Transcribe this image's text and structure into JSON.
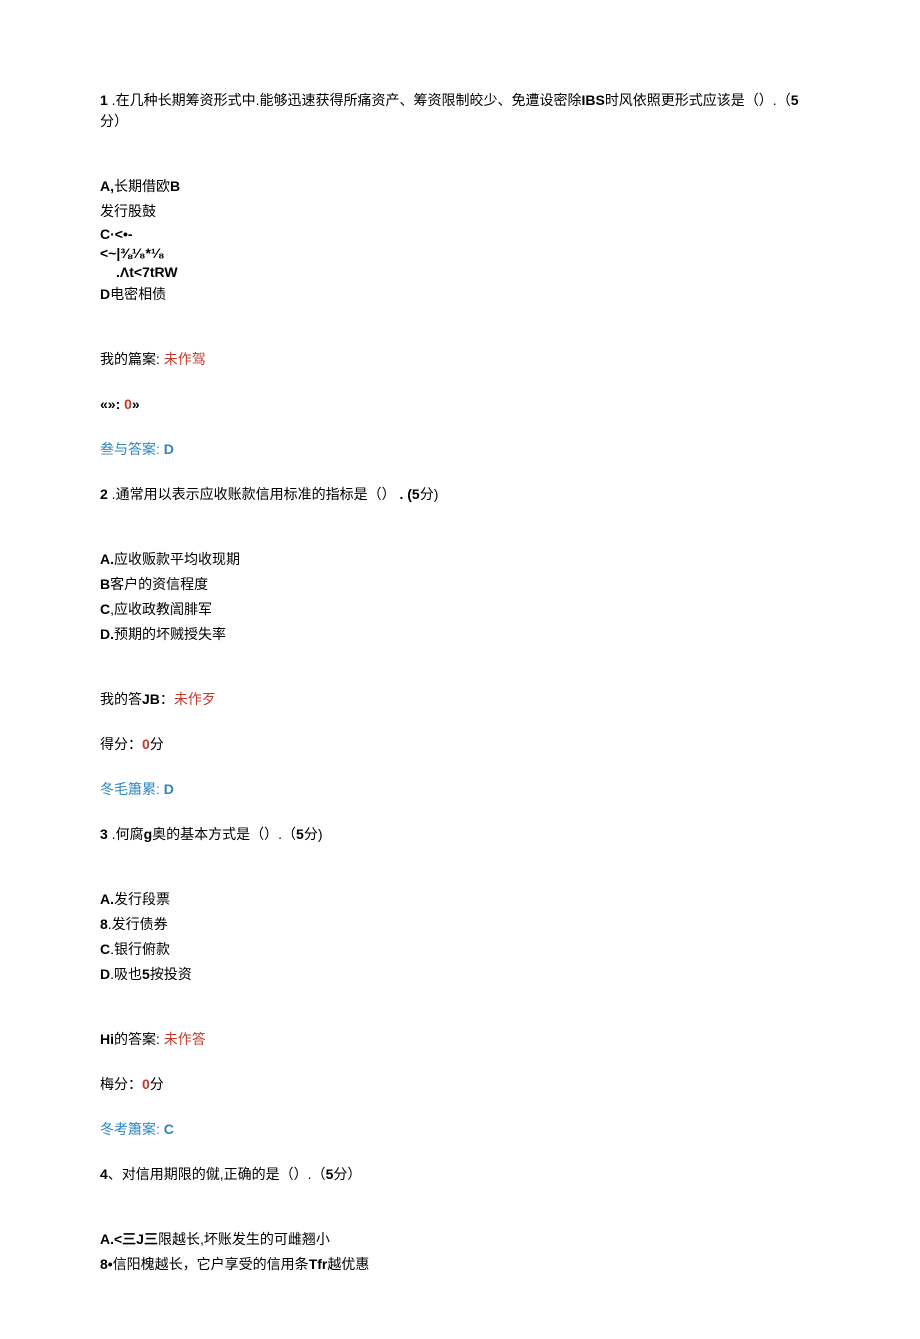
{
  "q1": {
    "number": "1",
    "text": " .在几种长期筹资形式中.能够迅速获得所痛资产、筹资限制皎少、免遭设密除",
    "keyword": "IBS",
    "text2": "时风依照更形式应该是（）.（",
    "pts_num": "5",
    "pts_unit": "分）",
    "options": {
      "A": {
        "label": "A,",
        "text": "长期借欧",
        "tail": "B"
      },
      "B": {
        "text": "发行股鼓"
      },
      "C": {
        "label": "C",
        "text": "·<•-"
      },
      "garble1": "<~|⅜¹⁄₈*¹⁄₈",
      "garble2": ".Λt<7tRW",
      "D": {
        "label": "D",
        "text": "电密相债"
      }
    },
    "myAnswerLabel": "我的篇案: ",
    "myAnswerStatus": "未作驾",
    "scoreLabel": "«»: ",
    "scoreValue": "0",
    "scoreUnit": "»",
    "refLabel": "叁与答案: ",
    "refAnswer": "D"
  },
  "q2": {
    "number": "2",
    "text": " .通常用以表示应收账款信用标准的指标是（）",
    "pts_label": " . (",
    "pts_num": "5",
    "pts_unit": "分)",
    "options": {
      "A": {
        "label": "A.",
        "text": "应收贩款平均收现期"
      },
      "B": {
        "label": "B",
        "text": "客户的资信程度"
      },
      "C": {
        "label": "C",
        "text": ",应收政教訚腓军"
      },
      "D": {
        "label": "D.",
        "text": "预期的坏贼授失率"
      }
    },
    "myAnswerLabel": "我的答",
    "myAnswerMid": "JB",
    "myAnswerColon": "：",
    "myAnswerStatus": "未作歹",
    "scoreLabel": "得分：",
    "scoreValue": "0",
    "scoreUnit": "分",
    "refLabel": "冬毛簫累: ",
    "refAnswer": "D"
  },
  "q3": {
    "number": "3",
    "text": " .何腐",
    "keyword": "g",
    "text2": "奥的基本方式是（）.（",
    "pts_num": "5",
    "pts_unit": "分)",
    "options": {
      "A": {
        "label": "A.",
        "text": "发行段票"
      },
      "B": {
        "label": "8",
        "text": ".发行债券"
      },
      "C": {
        "label": "C",
        "text": ".银行俯款"
      },
      "D": {
        "label": "D",
        "text": ".吸也",
        "tail": "5",
        "tail2": "按投资"
      }
    },
    "myAnswerLabel": "Hi",
    "myAnswerRest": "的答案: ",
    "myAnswerStatus": "未作答",
    "scoreLabel": "梅分：",
    "scoreValue": "0",
    "scoreUnit": "分",
    "refLabel": "冬考簫案: ",
    "refAnswer": "C"
  },
  "q4": {
    "number": "4",
    "text": "、对信用期限的僦,正确的是（）.（",
    "pts_num": "5",
    "pts_unit": "分）",
    "options": {
      "A": {
        "label": "A.",
        "mid": "<三J三",
        "text": "限越长,坏账发生的可雌翘小"
      },
      "B": {
        "label": "8•",
        "text": "信阳槐越长，它户享受的信用条",
        "mid": "Tfr",
        "tail": "越优惠"
      }
    }
  }
}
